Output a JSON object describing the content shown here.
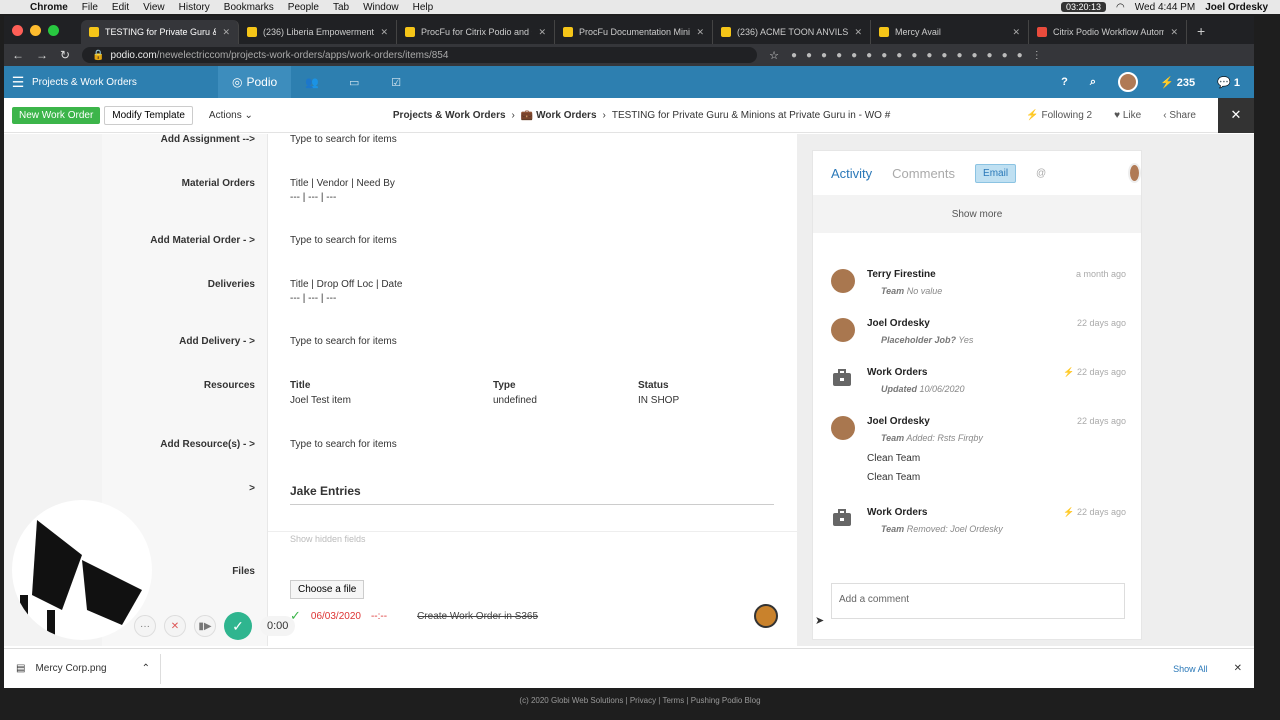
{
  "menubar": {
    "app": "Chrome",
    "menus": [
      "File",
      "Edit",
      "View",
      "History",
      "Bookmarks",
      "People",
      "Tab",
      "Window",
      "Help"
    ],
    "clock_badge": "03:20:13",
    "datetime": "Wed 4:44 PM",
    "user": "Joel Ordesky"
  },
  "browser": {
    "tabs": [
      {
        "title": "TESTING for Private Guru & Mi",
        "active": true,
        "color": "#f5c518"
      },
      {
        "title": "(236) Liberia Empowerment th",
        "active": false,
        "color": "#f5c518"
      },
      {
        "title": "ProcFu for Citrix Podio and Gl",
        "active": false,
        "color": "#f5c518"
      },
      {
        "title": "ProcFu Documentation Mini Ap",
        "active": false,
        "color": "#f5c518"
      },
      {
        "title": "(236) ACME TOON ANVILS | M",
        "active": false,
        "color": "#f5c518"
      },
      {
        "title": "Mercy Avail",
        "active": false,
        "color": "#f5c518"
      },
      {
        "title": "Citrix Podio Workflow Automati",
        "active": false,
        "color": "#e94b3c"
      }
    ],
    "url_host": "podio.com",
    "url_path": "/newelectriccom/projects-work-orders/apps/work-orders/items/854"
  },
  "podio_header": {
    "workspace": "Projects & Work Orders",
    "logo": "Podio",
    "notifications": "235",
    "messages": "1"
  },
  "toolbar": {
    "new_btn": "New Work Order",
    "modify_btn": "Modify Template",
    "actions": "Actions",
    "breadcrumb": [
      "Projects & Work Orders",
      "Work Orders",
      "TESTING for Private Guru & Minions at Private Guru in - WO #"
    ],
    "following": "Following",
    "following_count": "2",
    "like": "Like",
    "share": "Share"
  },
  "form": {
    "add_assignment_label": "Add Assignment -->",
    "add_assignment_ph": "Type to search for items",
    "material_orders_label": "Material Orders",
    "material_orders_hdr": "Title | Vendor | Need By",
    "material_orders_val": "--- | --- | ---",
    "add_material_label": "Add Material Order - >",
    "add_material_ph": "Type to search for items",
    "deliveries_label": "Deliveries",
    "deliveries_hdr": "Title | Drop Off Loc | Date",
    "deliveries_val": "--- | --- | ---",
    "add_delivery_label": "Add Delivery - >",
    "add_delivery_ph": "Type to search for items",
    "resources_label": "Resources",
    "resources_cols": [
      "Title",
      "Type",
      "Status"
    ],
    "resources_row": [
      "Joel Test item",
      "undefined",
      "IN SHOP"
    ],
    "add_resources_label": "Add Resource(s) - >",
    "add_resources_ph": "Type to search for items",
    "jake_label": ">",
    "jake_title": "Jake Entries",
    "show_hidden": "Show hidden fields",
    "files_label": "Files",
    "choose_file": "Choose a file",
    "task_date": "06/03/2020",
    "task_time": "--:--",
    "task_title": "Create Work Order in S365"
  },
  "activity": {
    "tab_activity": "Activity",
    "tab_comments": "Comments",
    "email_btn": "Email",
    "at": "@",
    "show_more": "Show more",
    "items": [
      {
        "name": "Terry Firestine",
        "when": "a month ago",
        "field": "Team",
        "value": "No value"
      },
      {
        "name": "Joel Ordesky",
        "when": "22 days ago",
        "field": "Placeholder Job?",
        "value": "Yes"
      },
      {
        "name": "Work Orders",
        "when": "22 days ago",
        "field": "Updated",
        "value": "10/06/2020"
      },
      {
        "name": "Joel Ordesky",
        "when": "22 days ago",
        "field": "Team",
        "value": "Added: Rsts Firqby",
        "extra": [
          "Clean Team",
          "Clean Team"
        ]
      },
      {
        "name": "Work Orders",
        "when": "22 days ago",
        "field": "Team",
        "value": "Removed: Joel Ordesky"
      }
    ],
    "comment_ph": "Add a comment"
  },
  "downloads": {
    "file": "Mercy Corp.png",
    "show_all": "Show All"
  },
  "recorder": {
    "time": "0:00"
  },
  "footer": "(c) 2020 Globi Web Solutions | Privacy | Terms | Pushing Podio Blog"
}
